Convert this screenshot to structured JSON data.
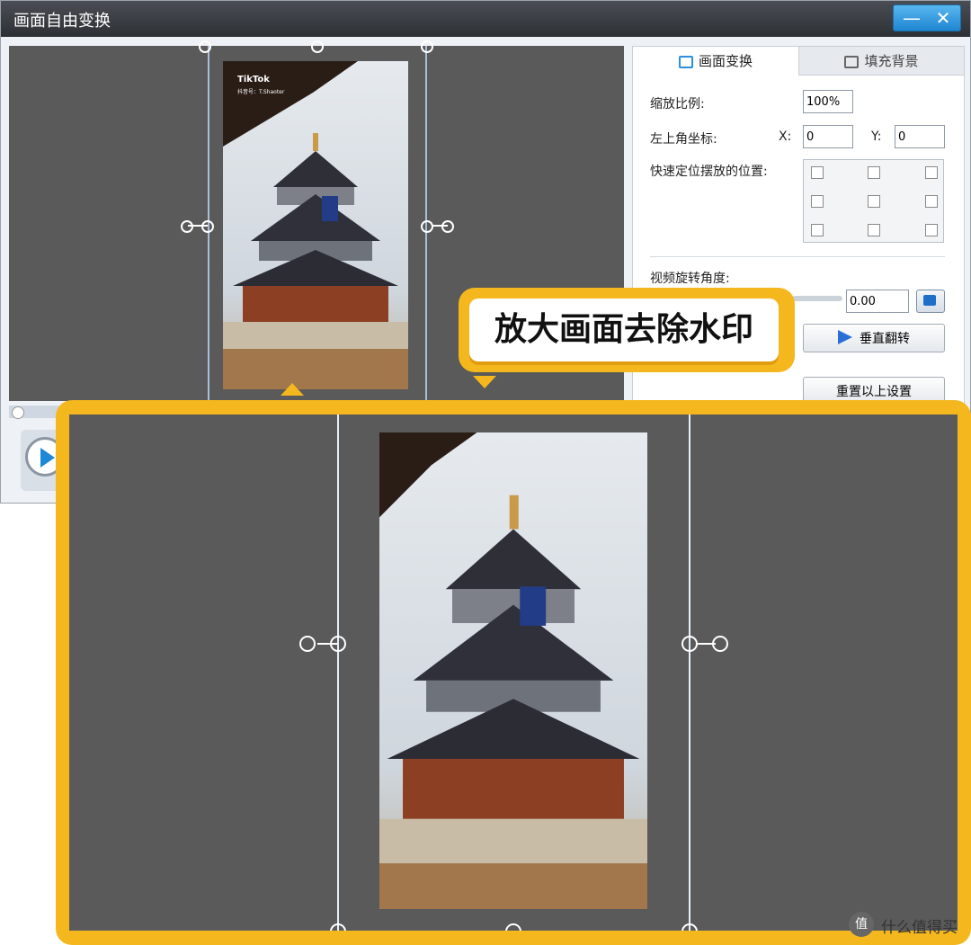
{
  "window": {
    "title": "画面自由变换",
    "minimize_glyph": "—",
    "close_glyph": "✕"
  },
  "preview": {
    "video_watermark_brand": "TikTok",
    "video_watermark_sub": "抖音号：T.Shaoter"
  },
  "panel": {
    "tabs": [
      {
        "label": "画面变换",
        "icon": "transform-icon",
        "active": true
      },
      {
        "label": "填充背景",
        "icon": "fill-background-icon",
        "active": false
      }
    ],
    "scale_label": "缩放比例:",
    "scale_value": "100%",
    "topleft_label": "左上角坐标:",
    "x_label": "X:",
    "x_value": "0",
    "y_label": "Y:",
    "y_value": "0",
    "quick_position_label": "快速定位摆放的位置:",
    "rotation_label": "视频旋转角度:",
    "rotation_value": "0.00",
    "vertical_flip_label": "垂直翻转",
    "reset_label": "重置以上设置"
  },
  "callout": {
    "text": "放大画面去除水印"
  },
  "watermark": {
    "logo_glyph": "值",
    "text": "什么值得买"
  },
  "colors": {
    "accent": "#f5b71e",
    "canvas": "#5a5a5a",
    "title_bar": "#2d3035",
    "window_button": "#1f86d3"
  }
}
